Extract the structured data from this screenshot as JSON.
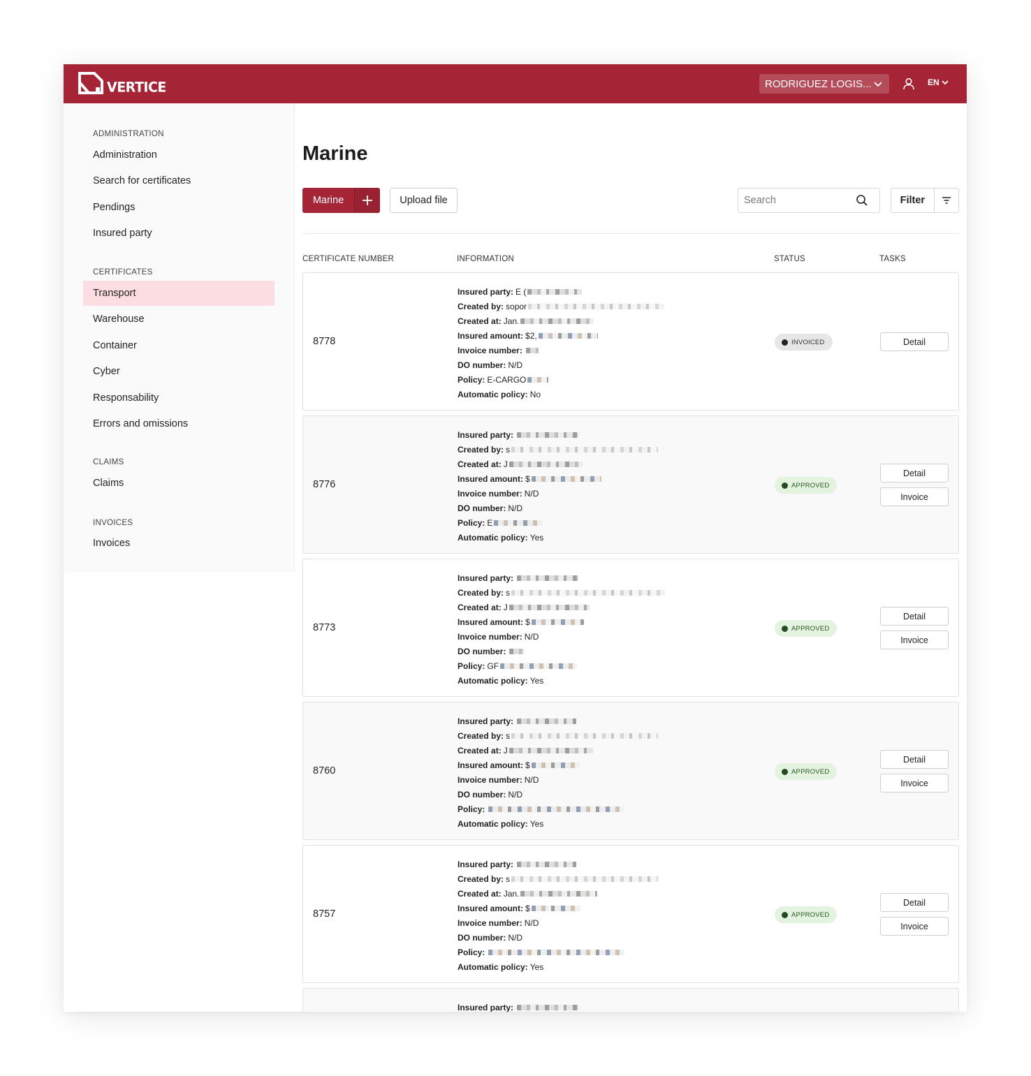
{
  "brand": {
    "color": "#a52536",
    "logo_text": "VERTICE"
  },
  "header": {
    "company": "RODRIGUEZ LOGIS...",
    "language": "EN"
  },
  "sidebar": {
    "sections": [
      {
        "title": "ADMINISTRATION",
        "items": [
          "Administration",
          "Search for certificates",
          "Pendings",
          "Insured party"
        ]
      },
      {
        "title": "CERTIFICATES",
        "items": [
          "Transport",
          "Warehouse",
          "Container",
          "Cyber",
          "Responsability",
          "Errors and omissions"
        ]
      },
      {
        "title": "CLAIMS",
        "items": [
          "Claims"
        ]
      },
      {
        "title": "INVOICES",
        "items": [
          "Invoices"
        ]
      }
    ],
    "active_item": "Transport"
  },
  "main": {
    "title": "Marine",
    "new_button": "Marine",
    "upload_button": "Upload file",
    "search_placeholder": "Search",
    "filter_button": "Filter"
  },
  "table": {
    "headers": [
      "CERTIFICATE NUMBER",
      "INFORMATION",
      "STATUS",
      "TASKS"
    ],
    "field_labels": [
      "Insured party:",
      "Created by:",
      "Created at:",
      "Insured amount:",
      "Invoice number:",
      "DO number:",
      "Policy:",
      "Automatic policy:"
    ],
    "rows": [
      {
        "number": "8778",
        "status": "INVOICED",
        "status_type": "invoiced",
        "tasks": [
          "Detail"
        ],
        "values": [
          "E (",
          "sopor",
          "Jan.",
          "$2,",
          "",
          "N/D",
          "E-CARGO",
          "No"
        ]
      },
      {
        "number": "8776",
        "status": "APPROVED",
        "status_type": "approved",
        "tasks": [
          "Detail",
          "Invoice"
        ],
        "values": [
          "",
          "s",
          "J",
          "$",
          "N/D",
          "N/D",
          "E",
          "Yes"
        ]
      },
      {
        "number": "8773",
        "status": "APPROVED",
        "status_type": "approved",
        "tasks": [
          "Detail",
          "Invoice"
        ],
        "values": [
          "",
          "s",
          "J",
          "$",
          "N/D",
          "",
          "GF",
          "Yes"
        ]
      },
      {
        "number": "8760",
        "status": "APPROVED",
        "status_type": "approved",
        "tasks": [
          "Detail",
          "Invoice"
        ],
        "values": [
          "",
          "s",
          "J",
          "$",
          "N/D",
          "N/D",
          "",
          "Yes"
        ]
      },
      {
        "number": "8757",
        "status": "APPROVED",
        "status_type": "approved",
        "tasks": [
          "Detail",
          "Invoice"
        ],
        "values": [
          "",
          "s",
          "Jan.",
          "$",
          "N/D",
          "N/D",
          "",
          "Yes"
        ]
      },
      {
        "number": "",
        "status": "",
        "status_type": "",
        "tasks": [],
        "values": [
          ""
        ]
      }
    ]
  }
}
